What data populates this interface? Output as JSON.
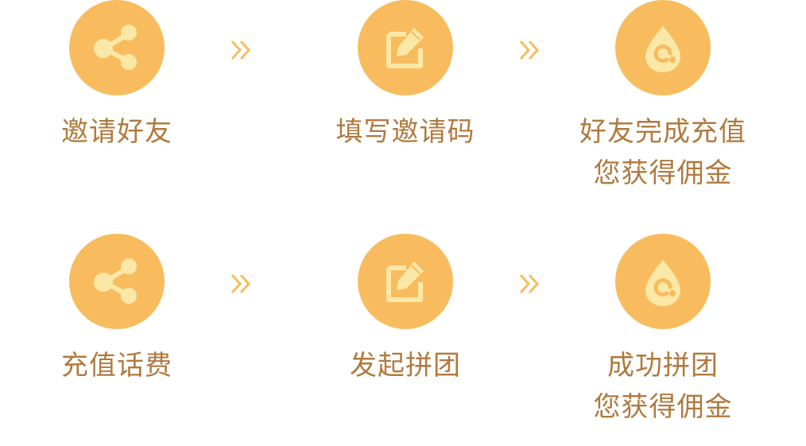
{
  "colors": {
    "circle": "#f8bc5e",
    "icon": "#fbe8a7",
    "arrow": "#f8bc5e",
    "text": "#b07a3e"
  },
  "invite_flow": {
    "steps": [
      {
        "icon": "share-icon",
        "line1": "邀请好友",
        "line2": ""
      },
      {
        "icon": "edit-icon",
        "line1": "填写邀请码",
        "line2": ""
      },
      {
        "icon": "drop-icon",
        "line1": "好友完成充值",
        "line2": "您获得佣金"
      }
    ]
  },
  "group_flow": {
    "steps": [
      {
        "icon": "share-icon",
        "line1": "充值话费",
        "line2": ""
      },
      {
        "icon": "edit-icon",
        "line1": "发起拼团",
        "line2": ""
      },
      {
        "icon": "drop-icon",
        "line1": "成功拼团",
        "line2": "您获得佣金"
      }
    ]
  }
}
